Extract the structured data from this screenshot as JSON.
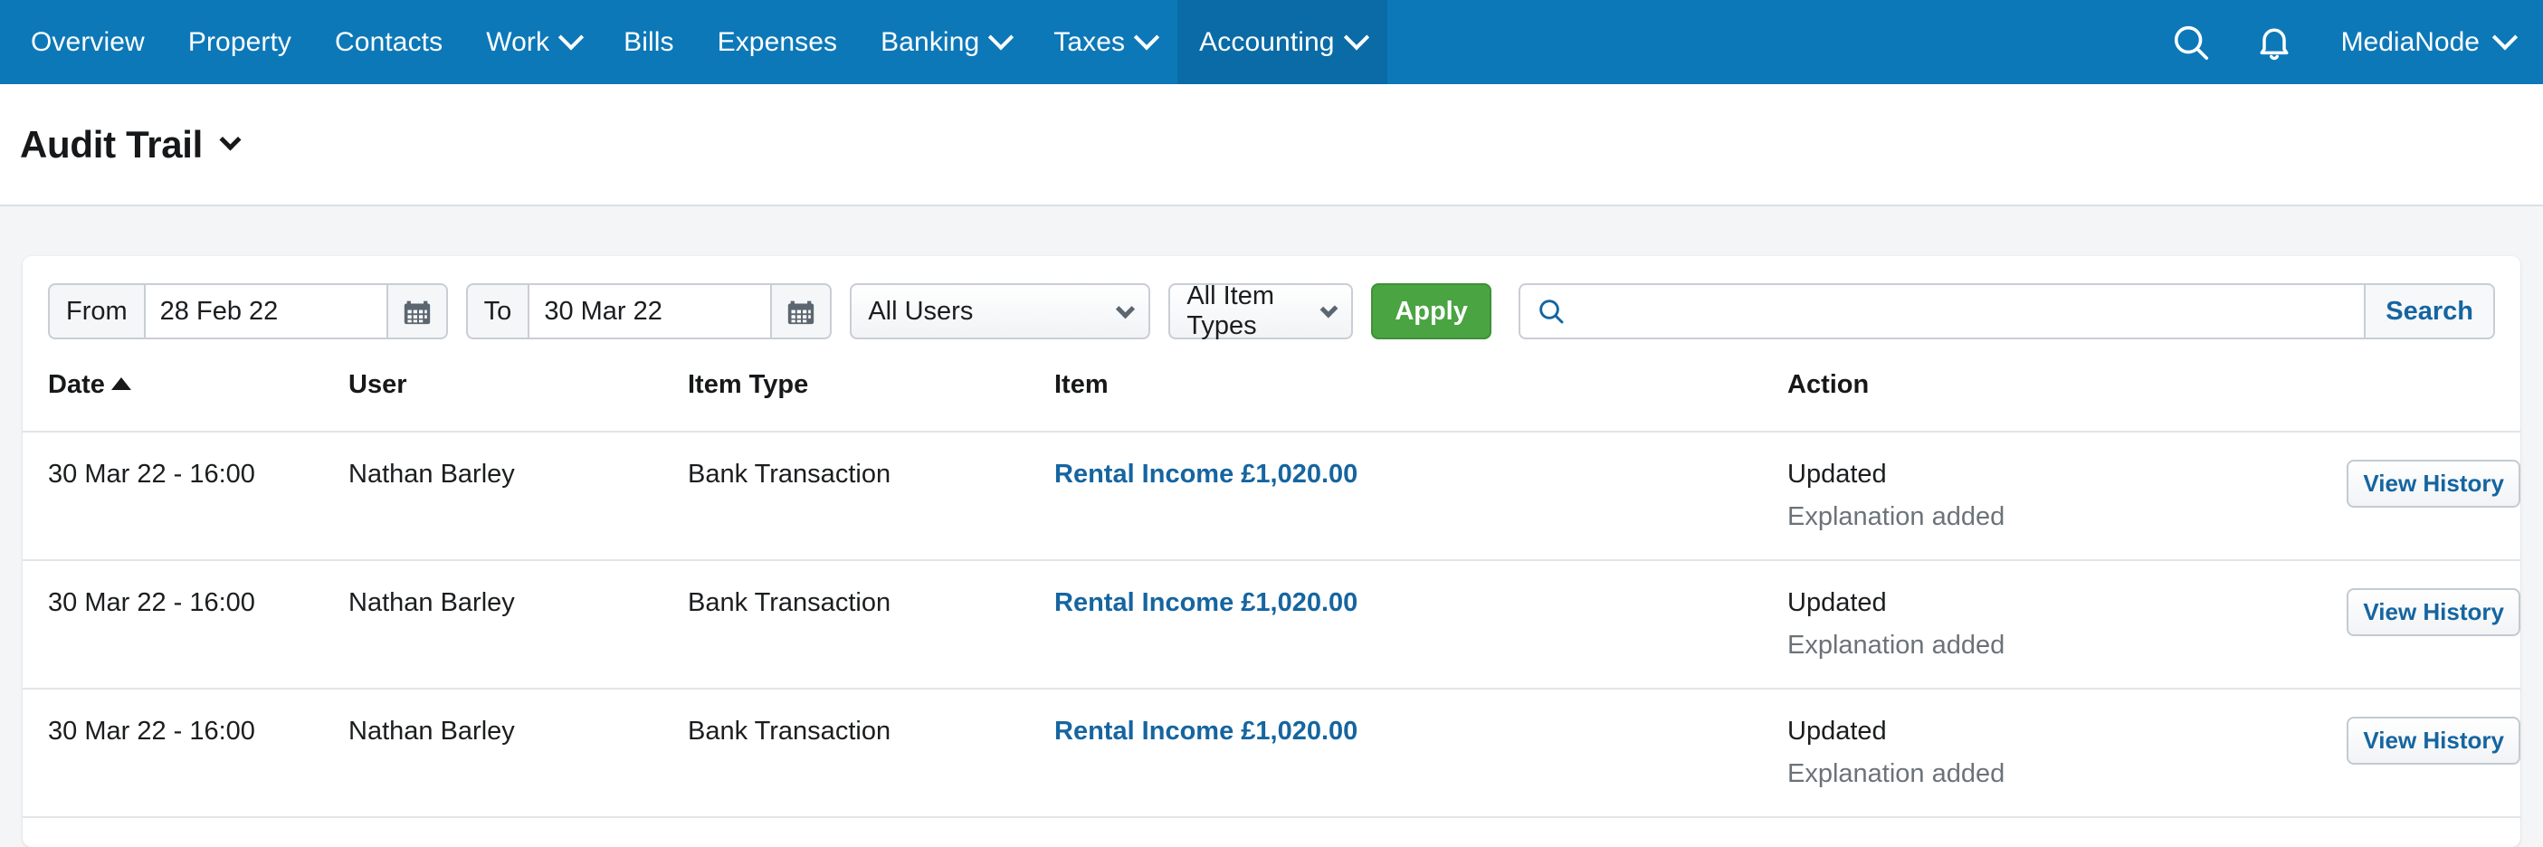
{
  "nav": {
    "items": [
      {
        "label": "Overview",
        "has_caret": false,
        "active": false
      },
      {
        "label": "Property",
        "has_caret": false,
        "active": false
      },
      {
        "label": "Contacts",
        "has_caret": false,
        "active": false
      },
      {
        "label": "Work",
        "has_caret": true,
        "active": false
      },
      {
        "label": "Bills",
        "has_caret": false,
        "active": false
      },
      {
        "label": "Expenses",
        "has_caret": false,
        "active": false
      },
      {
        "label": "Banking",
        "has_caret": true,
        "active": false
      },
      {
        "label": "Taxes",
        "has_caret": true,
        "active": false
      },
      {
        "label": "Accounting",
        "has_caret": true,
        "active": true
      }
    ],
    "search_icon": "search-icon",
    "bell_icon": "bell-icon",
    "account_name": "MediaNode",
    "bar_color": "#0c78b8",
    "active_tab_color": "#0a6ba6"
  },
  "header": {
    "title": "Audit Trail"
  },
  "filters": {
    "from_label": "From",
    "from_value": "28 Feb 22",
    "from_placeholder": "",
    "to_label": "To",
    "to_value": "30 Mar 22",
    "to_placeholder": "",
    "calendar_icon": "calendar-icon",
    "user_select": "All Users",
    "item_type_select": "All Item Types",
    "apply_label": "Apply",
    "apply_color": "#4aa441",
    "search_value": "",
    "search_placeholder": "",
    "search_button_label": "Search",
    "search_icon": "search-icon"
  },
  "table": {
    "columns": [
      {
        "label": "Date",
        "sorted": "asc"
      },
      {
        "label": "User",
        "sorted": ""
      },
      {
        "label": "Item Type",
        "sorted": ""
      },
      {
        "label": "Item",
        "sorted": ""
      },
      {
        "label": "Action",
        "sorted": ""
      },
      {
        "label": "",
        "sorted": ""
      }
    ],
    "rows": [
      {
        "date": "30 Mar 22 - 16:00",
        "user": "Nathan Barley",
        "item_type": "Bank Transaction",
        "item": "Rental Income £1,020.00",
        "action": "Updated",
        "action_detail": "Explanation added",
        "button": "View History"
      },
      {
        "date": "30 Mar 22 - 16:00",
        "user": "Nathan Barley",
        "item_type": "Bank Transaction",
        "item": "Rental Income £1,020.00",
        "action": "Updated",
        "action_detail": "Explanation added",
        "button": "View History"
      },
      {
        "date": "30 Mar 22 - 16:00",
        "user": "Nathan Barley",
        "item_type": "Bank Transaction",
        "item": "Rental Income £1,020.00",
        "action": "Updated",
        "action_detail": "Explanation added",
        "button": "View History"
      }
    ]
  },
  "colors": {
    "link": "#1565a0",
    "muted": "#6b7378",
    "page_background": "#f3f5f7"
  }
}
